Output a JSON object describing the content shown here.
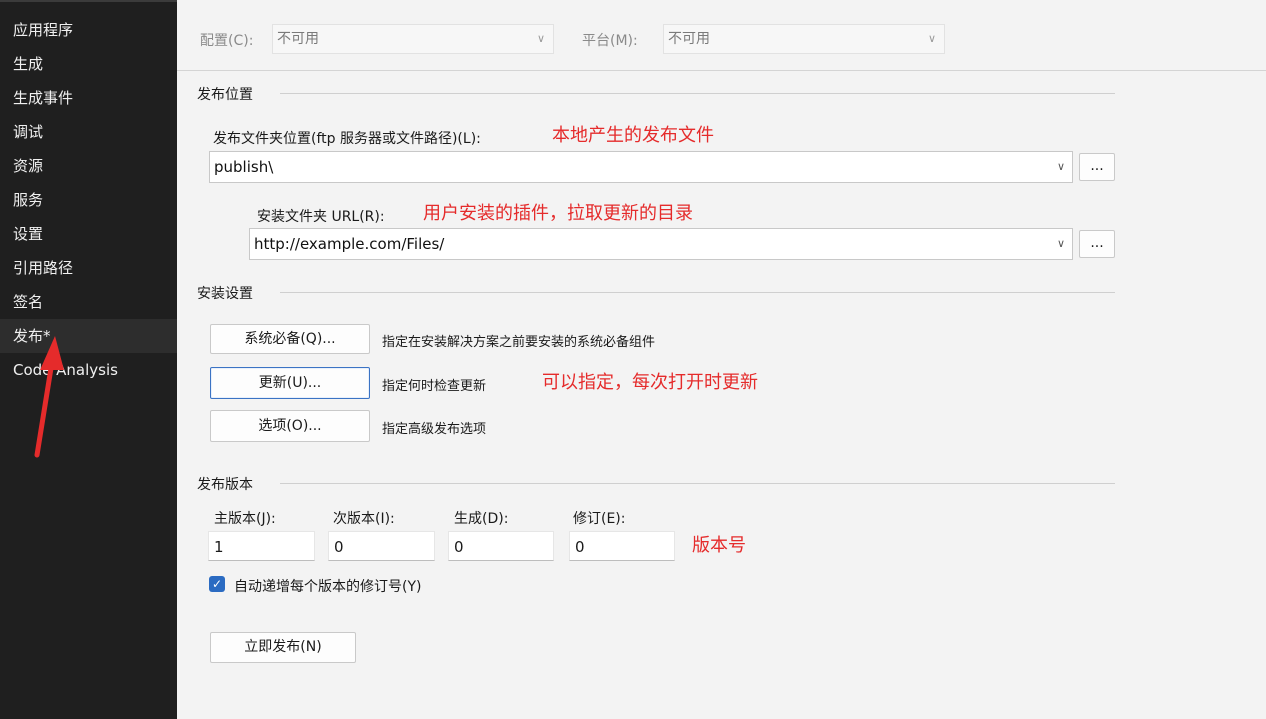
{
  "sidebar": {
    "items": [
      {
        "label": "应用程序"
      },
      {
        "label": "生成"
      },
      {
        "label": "生成事件"
      },
      {
        "label": "调试"
      },
      {
        "label": "资源"
      },
      {
        "label": "服务"
      },
      {
        "label": "设置"
      },
      {
        "label": "引用路径"
      },
      {
        "label": "签名"
      },
      {
        "label": "发布*",
        "active": true
      },
      {
        "label": "Code Analysis"
      }
    ]
  },
  "config_bar": {
    "config_label": "配置(C):",
    "config_value": "不可用",
    "platform_label": "平台(M):",
    "platform_value": "不可用"
  },
  "publish_location": {
    "section_title": "发布位置",
    "folder_label": "发布文件夹位置(ftp 服务器或文件路径)(L):",
    "folder_value": "publish\\",
    "folder_annotation": "本地产生的发布文件",
    "browse_label": "...",
    "url_label": "安装文件夹 URL(R):",
    "url_value": "http://example.com/Files/",
    "url_annotation": "用户安装的插件，拉取更新的目录"
  },
  "install_settings": {
    "section_title": "安装设置",
    "prereq_button": "系统必备(Q)...",
    "prereq_desc": "指定在安装解决方案之前要安装的系统必备组件",
    "update_button": "更新(U)...",
    "update_desc": "指定何时检查更新",
    "update_annotation": "可以指定，每次打开时更新",
    "options_button": "选项(O)...",
    "options_desc": "指定高级发布选项"
  },
  "publish_version": {
    "section_title": "发布版本",
    "major_label": "主版本(J):",
    "major_value": "1",
    "minor_label": "次版本(I):",
    "minor_value": "0",
    "build_label": "生成(D):",
    "build_value": "0",
    "revision_label": "修订(E):",
    "revision_value": "0",
    "version_annotation": "版本号",
    "auto_increment_label": "自动递增每个版本的修订号(Y)",
    "auto_increment_checked": true
  },
  "publish_now_button": "立即发布(N)",
  "colors": {
    "annotation_red": "#e52b2b",
    "sidebar_bg": "#1f1f1f",
    "checkbox_blue": "#2b6bc2"
  }
}
